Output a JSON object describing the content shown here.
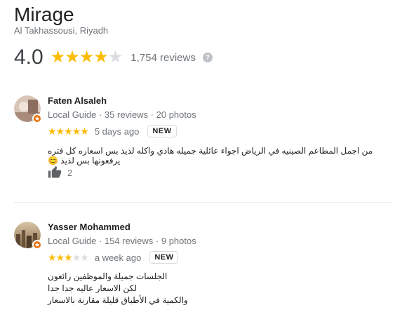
{
  "place": {
    "name": "Mirage",
    "address": "Al Takhassousi, Riyadh",
    "rating": "4.0",
    "rating_value": 4,
    "reviews_count": "1,754 reviews",
    "help_icon": "help-icon"
  },
  "reviews": [
    {
      "author": "Faten Alsaleh",
      "meta": "Local Guide · 35 reviews · 20 photos",
      "stars": 5,
      "time": "5 days ago",
      "badge": "NEW",
      "text": "من اجمل المطاعم الصينيه في الرياض اجواء عائلية جميله هادي واكله لذيذ بس اسعاره كل فتره يرفعونها بس لذيذ 😊",
      "likes": "2"
    },
    {
      "author": "Yasser Mohammed",
      "meta": "Local Guide · 154 reviews · 9 photos",
      "stars": 3,
      "time": "a week ago",
      "badge": "NEW",
      "text_lines": [
        "الجلسات جميلة والموظفين رائعون",
        "لكن الاسعار عاليه جدا جدا",
        "والكمية في الأطباق قليلة مقارنة بالاسعار"
      ]
    }
  ],
  "colors": {
    "star": "#fbbc04",
    "star_empty": "#dadce0",
    "badge": "#e8710a"
  }
}
